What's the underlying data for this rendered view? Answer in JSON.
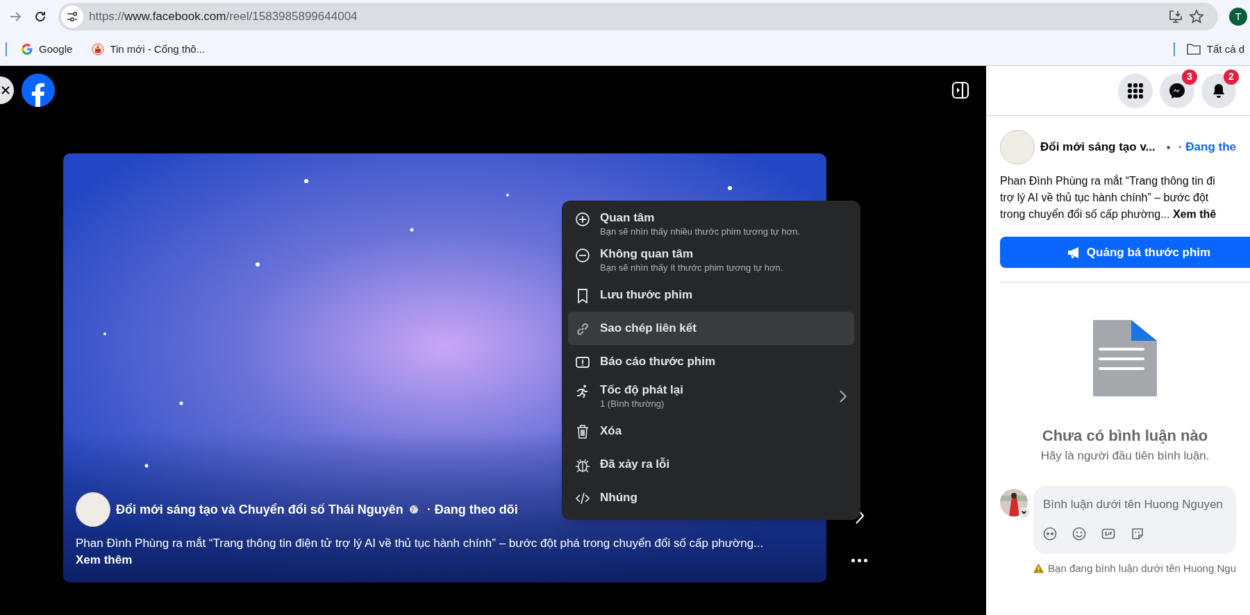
{
  "browser": {
    "url_scheme": "https://",
    "url_host": "www.facebook.com",
    "url_path": "/reel/1583985899644004",
    "profile_initial": "T",
    "bookmarks": [
      {
        "label": "Google"
      },
      {
        "label": "Tin mới - Cổng thô..."
      }
    ],
    "bookmarks_folder": "Tất cả d"
  },
  "reel": {
    "page_name": "Đổi mới sáng tạo và Chuyển đổi số Thái Nguyên",
    "follow_status": "· Đang theo dõi",
    "caption": "Phan Đình Phùng ra mắt “Trang thông tin điện tử trợ lý AI về thủ tục hành chính” – bước đột phá trong chuyển đổi số cấp phường... **Xem thêm**"
  },
  "menu": {
    "items": [
      {
        "label": "Quan tâm",
        "description": "Bạn sẽ nhìn thấy nhiều thước phim tương tự hơn.",
        "highlighted": false,
        "submenu": false
      },
      {
        "label": "Không quan tâm",
        "description": "Bạn sẽ nhìn thấy ít thước phim tương tự hơn.",
        "highlighted": false,
        "submenu": false
      },
      {
        "label": "Lưu thước phim",
        "highlighted": false,
        "submenu": false
      },
      {
        "label": "Sao chép liên kết",
        "highlighted": true,
        "submenu": false
      },
      {
        "label": "Báo cáo thước phim",
        "highlighted": false,
        "submenu": false
      },
      {
        "label": "Tốc độ phát lại",
        "description": "1 (Bình thường)",
        "highlighted": false,
        "submenu": true
      },
      {
        "label": "Xóa",
        "highlighted": false,
        "submenu": false
      },
      {
        "label": "Đã xảy ra lỗi",
        "highlighted": false,
        "submenu": false
      },
      {
        "label": "Nhúng",
        "highlighted": false,
        "submenu": false
      }
    ]
  },
  "header": {
    "messenger_badge": "3",
    "notifications_badge": "2"
  },
  "post": {
    "page_name": "Đổi mới sáng tạo v...",
    "follow_status": "· Đang the",
    "caption_lines": [
      "Phan Đình Phùng ra mắt “Trang thông tin đi",
      "trợ lý AI về thủ tục hành chính” – bước đột",
      "trong chuyển đổi số cấp phường... **Xem thê**"
    ],
    "promote_button": "Quảng bá thước phim"
  },
  "comments": {
    "empty_title": "Chưa có bình luận nào",
    "empty_subtitle": "Hãy là người đầu tiên bình luận.",
    "placeholder": "Bình luận dưới tên Huong Nguyen",
    "warning": "Bạn đang bình luận dưới tên Huong Ngu"
  }
}
